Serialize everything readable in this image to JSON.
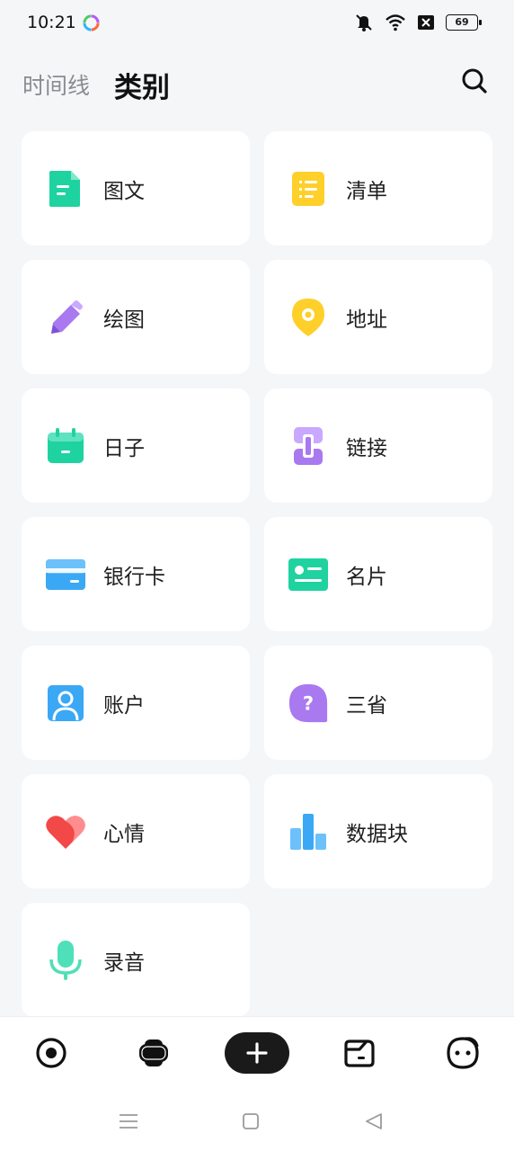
{
  "status": {
    "time": "10:21",
    "battery": "69"
  },
  "header": {
    "tab_timeline": "时间线",
    "tab_category": "类别"
  },
  "categories": [
    {
      "label": "图文",
      "icon": "document-icon",
      "color": "#1ed3a0"
    },
    {
      "label": "清单",
      "icon": "checklist-icon",
      "color": "#ffcf2a"
    },
    {
      "label": "绘图",
      "icon": "pencil-icon",
      "color": "#a979f0"
    },
    {
      "label": "地址",
      "icon": "location-pin-icon",
      "color": "#ffcf2a"
    },
    {
      "label": "日子",
      "icon": "calendar-icon",
      "color": "#1ed3a0"
    },
    {
      "label": "链接",
      "icon": "link-icon",
      "color": "#a979f0"
    },
    {
      "label": "银行卡",
      "icon": "bank-card-icon",
      "color": "#3aa8f5"
    },
    {
      "label": "名片",
      "icon": "business-card-icon",
      "color": "#1ed3a0"
    },
    {
      "label": "账户",
      "icon": "account-icon",
      "color": "#3aa8f5"
    },
    {
      "label": "三省",
      "icon": "question-bubble-icon",
      "color": "#a979f0"
    },
    {
      "label": "心情",
      "icon": "heart-icon",
      "color": "#f24848"
    },
    {
      "label": "数据块",
      "icon": "bar-chart-icon",
      "color": "#3aa8f5"
    },
    {
      "label": "录音",
      "icon": "microphone-icon",
      "color": "#4ee0b8"
    }
  ],
  "bottom_nav": [
    "target-icon",
    "cards-icon",
    "add-icon",
    "folder-icon",
    "profile-face-icon"
  ]
}
